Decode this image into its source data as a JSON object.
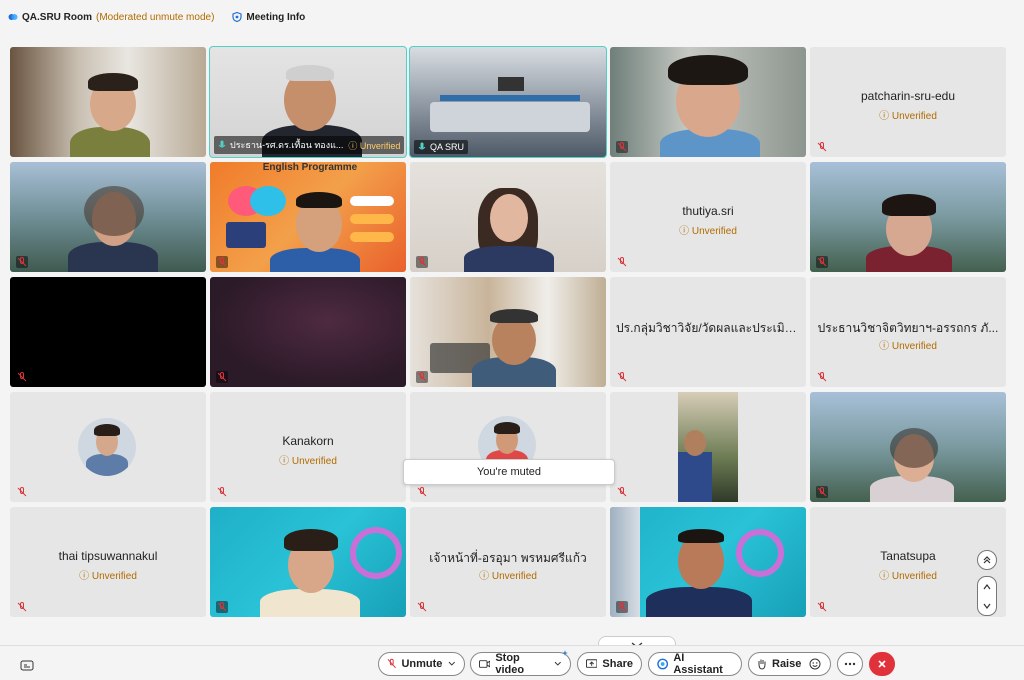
{
  "topbar": {
    "room": "QA.SRU Room",
    "mode": "(Moderated unmute mode)",
    "meeting_info": "Meeting Info"
  },
  "unverified": "Unverified",
  "tiles": {
    "r1c2_label": "ประธาน-รศ.ดร.เทื้อน ทองแ...",
    "r1c3_label": "QA SRU",
    "r1c5_name": "patcharin-sru-edu",
    "r2c2_banner": "English Programme",
    "r2c4_name": "thutiya.sri",
    "r3c4_name": "ปร.กลุ่มวิชาวิจัย/วัดผลและประเมิน...",
    "r3c5_name": "ประธานวิชาจิตวิทยาฯ-อรรถกร ภั...",
    "r4c2_name": "Kanakorn",
    "r5c1_name": "thai tipsuwannakul",
    "r5c3_name": "เจ้าหน้าที่-อรอุมา พรหมศรีแก้ว",
    "r5c5_name": "Tanatsupa"
  },
  "toast": "You're muted",
  "controls": {
    "unmute": "Unmute",
    "stop_video": "Stop video",
    "share": "Share",
    "ai_assistant": "AI Assistant",
    "raise": "Raise"
  },
  "colors": {
    "unverified": "#b26b00",
    "active_border": "#4fd1c5",
    "leave": "#e0323a",
    "muted_mic": "#d9343a"
  }
}
